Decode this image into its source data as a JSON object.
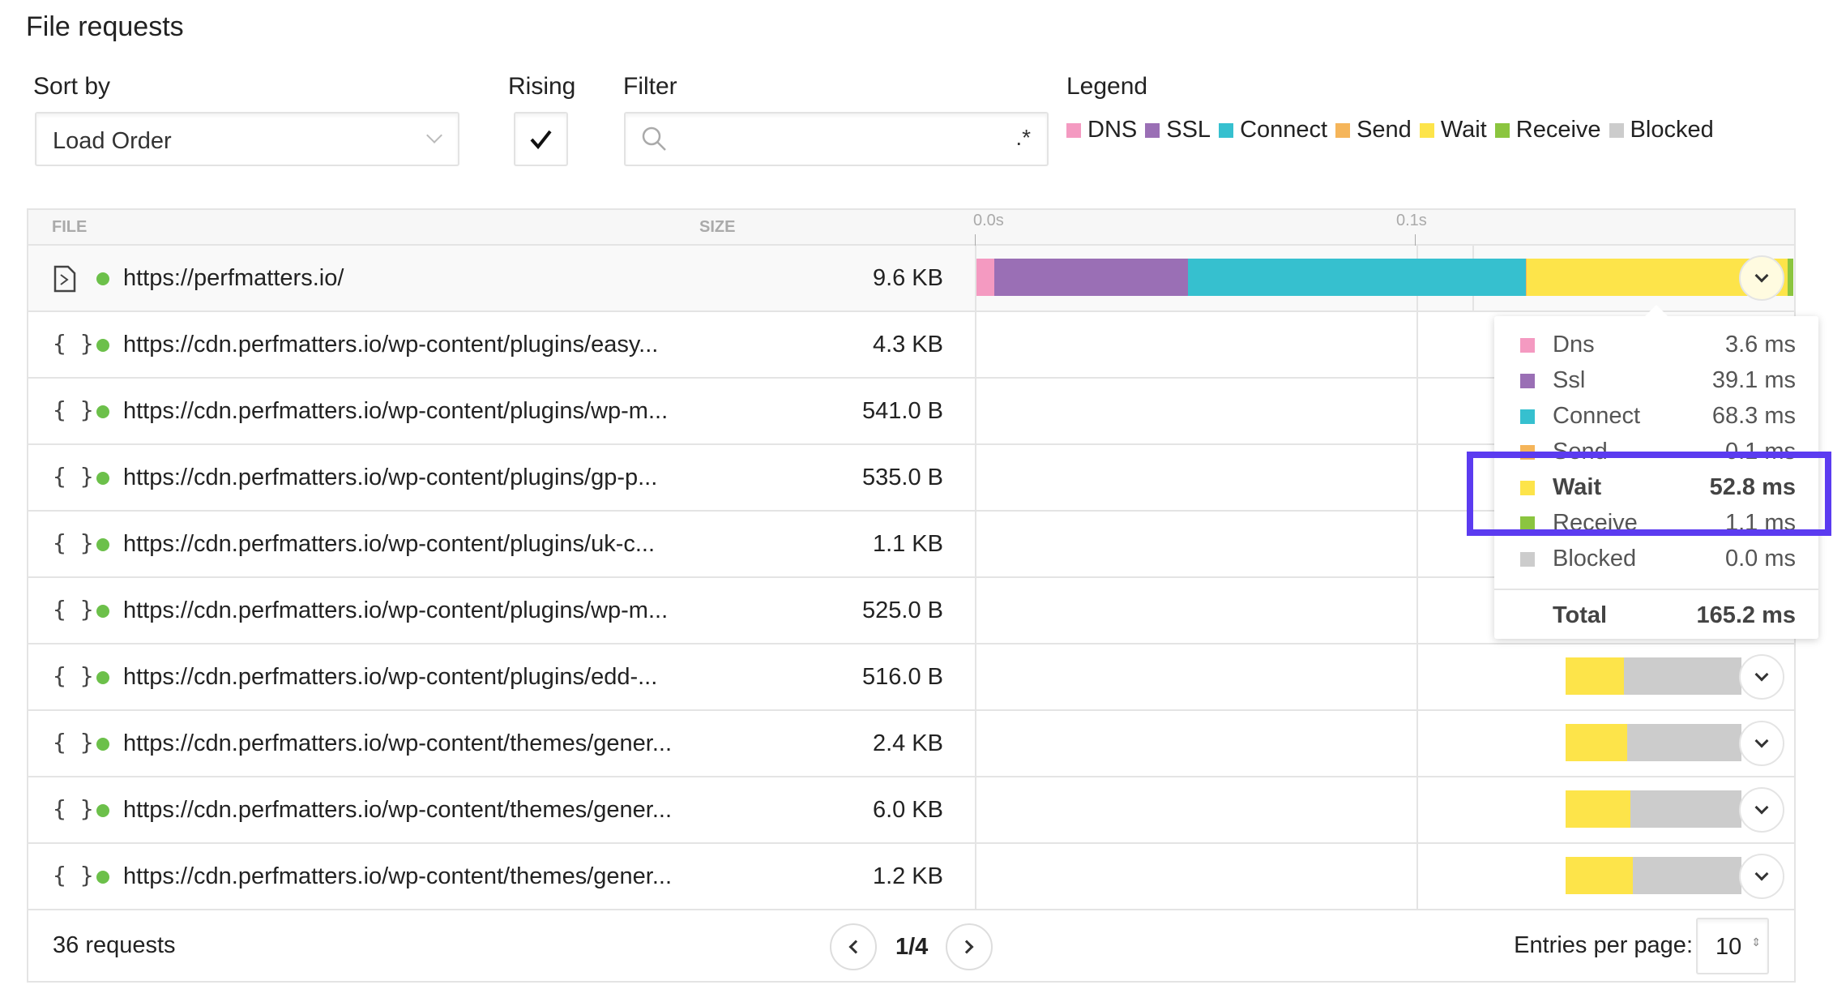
{
  "title": "File requests",
  "controls": {
    "sort_label": "Sort by",
    "sort_value": "Load Order",
    "rising_label": "Rising",
    "rising_checked": true,
    "filter_label": "Filter",
    "filter_value": "",
    "filter_regex": ".*",
    "legend_label": "Legend"
  },
  "legend": [
    {
      "label": "DNS",
      "color": "#f49ac1"
    },
    {
      "label": "SSL",
      "color": "#9a6fb5"
    },
    {
      "label": "Connect",
      "color": "#36c0cf"
    },
    {
      "label": "Send",
      "color": "#f5b55a"
    },
    {
      "label": "Wait",
      "color": "#fde44a"
    },
    {
      "label": "Receive",
      "color": "#8bc53f"
    },
    {
      "label": "Blocked",
      "color": "#cccccc"
    }
  ],
  "table": {
    "col_file": "FILE",
    "col_size": "SIZE",
    "ticks": [
      "0.0s",
      "0.1s"
    ],
    "rows": [
      {
        "icon": "html-file-icon",
        "url": "https://perfmatters.io/",
        "size": "9.6 KB",
        "timing": {
          "start": 0,
          "dns": 3.6,
          "ssl": 39.1,
          "connect": 68.3,
          "send": 0.1,
          "wait": 52.8,
          "receive": 1.1,
          "blocked": 0.0
        }
      },
      {
        "icon": "json-icon",
        "url": "https://cdn.perfmatters.io/wp-content/plugins/easy...",
        "size": "4.3 KB"
      },
      {
        "icon": "json-icon",
        "url": "https://cdn.perfmatters.io/wp-content/plugins/wp-m...",
        "size": "541.0 B"
      },
      {
        "icon": "json-icon",
        "url": "https://cdn.perfmatters.io/wp-content/plugins/gp-p...",
        "size": "535.0 B"
      },
      {
        "icon": "json-icon",
        "url": "https://cdn.perfmatters.io/wp-content/plugins/uk-c...",
        "size": "1.1 KB"
      },
      {
        "icon": "json-icon",
        "url": "https://cdn.perfmatters.io/wp-content/plugins/wp-m...",
        "size": "525.0 B"
      },
      {
        "icon": "json-icon",
        "url": "https://cdn.perfmatters.io/wp-content/plugins/edd-...",
        "size": "516.0 B",
        "timing": {
          "start": 119,
          "wait": 11.8,
          "blocked": 23.7
        }
      },
      {
        "icon": "json-icon",
        "url": "https://cdn.perfmatters.io/wp-content/themes/gener...",
        "size": "2.4 KB",
        "timing": {
          "start": 119,
          "wait": 12.5,
          "blocked": 23
        }
      },
      {
        "icon": "json-icon",
        "url": "https://cdn.perfmatters.io/wp-content/themes/gener...",
        "size": "6.0 KB",
        "timing": {
          "start": 119,
          "wait": 13,
          "blocked": 22.5
        }
      },
      {
        "icon": "json-icon",
        "url": "https://cdn.perfmatters.io/wp-content/themes/gener...",
        "size": "1.2 KB",
        "timing": {
          "start": 119,
          "wait": 13.5,
          "blocked": 22
        }
      }
    ]
  },
  "popover": {
    "items": [
      {
        "label": "Dns",
        "value": "3.6 ms",
        "color": "#f49ac1"
      },
      {
        "label": "Ssl",
        "value": "39.1 ms",
        "color": "#9a6fb5"
      },
      {
        "label": "Connect",
        "value": "68.3 ms",
        "color": "#36c0cf"
      },
      {
        "label": "Send",
        "value": "0.1 ms",
        "color": "#f5b55a"
      },
      {
        "label": "Wait",
        "value": "52.8 ms",
        "color": "#fde44a",
        "highlighted": true
      },
      {
        "label": "Receive",
        "value": "1.1 ms",
        "color": "#8bc53f"
      },
      {
        "label": "Blocked",
        "value": "0.0 ms",
        "color": "#cccccc"
      }
    ],
    "total_label": "Total",
    "total_value": "165.2 ms"
  },
  "footer": {
    "count": "36 requests",
    "page": "1/4",
    "entries_label": "Entries per page:",
    "entries_value": "10"
  }
}
